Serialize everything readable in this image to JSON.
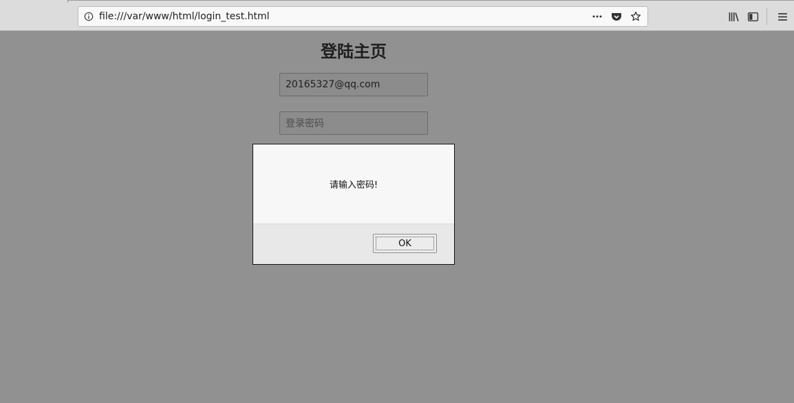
{
  "browser": {
    "url": "file:///var/www/html/login_test.html",
    "icons": {
      "info": "info-icon",
      "more": "more-actions-icon",
      "pocket": "pocket-icon",
      "bookmark": "bookmark-star-icon",
      "library": "library-icon",
      "sidebar": "sidebar-icon",
      "menu": "hamburger-menu-icon"
    }
  },
  "page": {
    "title": "登陆主页",
    "email_value": "20165327@qq.com",
    "password_placeholder": "登录密码"
  },
  "dialog": {
    "message": "请输入密码!",
    "ok_label": "OK"
  },
  "colors": {
    "overlay": "#919191",
    "dialog_bg": "#f7f7f7",
    "dialog_footer": "#e8e8e8"
  }
}
